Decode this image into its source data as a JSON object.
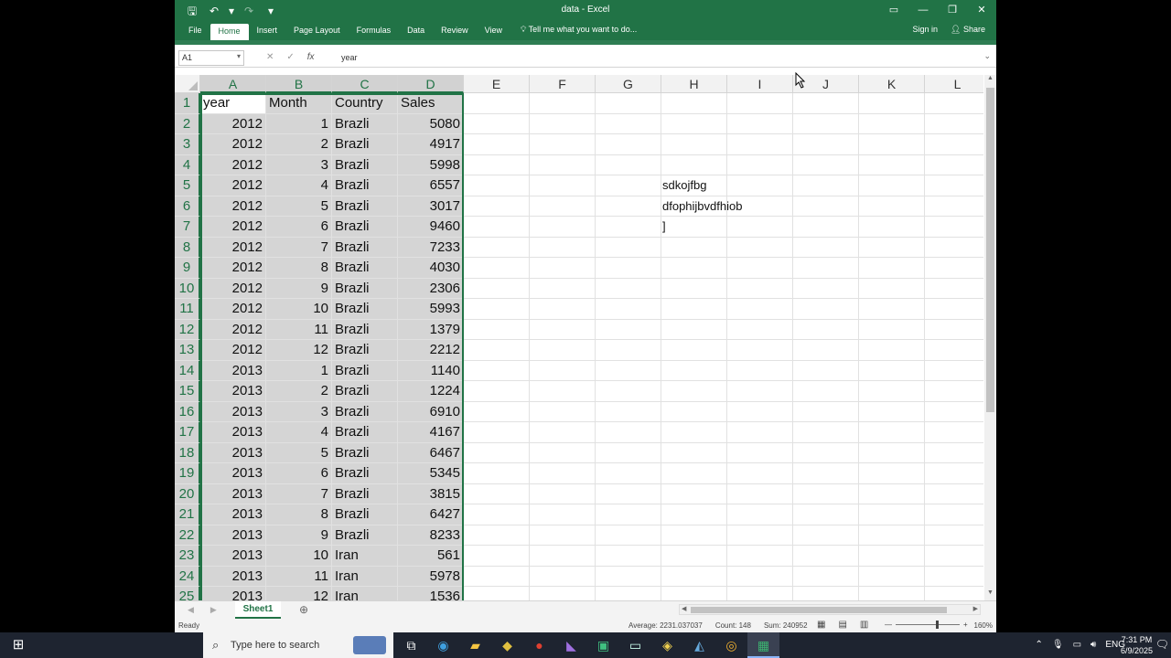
{
  "window": {
    "title": "data - Excel",
    "qat": {
      "save": "🖫",
      "undo": "↶",
      "undo_dd": "▾",
      "redo": "↷",
      "customize": "▾"
    },
    "controls": {
      "ribbon_display": "▭",
      "minimize": "—",
      "restore": "❐",
      "close": "✕"
    }
  },
  "ribbon": {
    "tabs": [
      "File",
      "Home",
      "Insert",
      "Page Layout",
      "Formulas",
      "Data",
      "Review",
      "View"
    ],
    "active_tab": "Home",
    "tell_me": "Tell me what you want to do...",
    "sign_in": "Sign in",
    "share": "Share"
  },
  "formula_bar": {
    "name_box": "A1",
    "cancel": "✕",
    "enter": "✓",
    "fx": "fx",
    "value": "year"
  },
  "columns": [
    {
      "label": "A"
    },
    {
      "label": "B"
    },
    {
      "label": "C"
    },
    {
      "label": "D"
    },
    {
      "label": "E"
    },
    {
      "label": "F"
    },
    {
      "label": "G"
    },
    {
      "label": "H"
    },
    {
      "label": "I"
    },
    {
      "label": "J"
    },
    {
      "label": "K"
    },
    {
      "label": "L"
    }
  ],
  "rows": [
    [
      "1",
      "year",
      "Month",
      "Country",
      "Sales"
    ],
    [
      "2",
      "2012",
      "1",
      "Brazli",
      "5080"
    ],
    [
      "3",
      "2012",
      "2",
      "Brazli",
      "4917"
    ],
    [
      "4",
      "2012",
      "3",
      "Brazli",
      "5998"
    ],
    [
      "5",
      "2012",
      "4",
      "Brazli",
      "6557"
    ],
    [
      "6",
      "2012",
      "5",
      "Brazli",
      "3017"
    ],
    [
      "7",
      "2012",
      "6",
      "Brazli",
      "9460"
    ],
    [
      "8",
      "2012",
      "7",
      "Brazli",
      "7233"
    ],
    [
      "9",
      "2012",
      "8",
      "Brazli",
      "4030"
    ],
    [
      "10",
      "2012",
      "9",
      "Brazli",
      "2306"
    ],
    [
      "11",
      "2012",
      "10",
      "Brazli",
      "5993"
    ],
    [
      "12",
      "2012",
      "11",
      "Brazli",
      "1379"
    ],
    [
      "13",
      "2012",
      "12",
      "Brazli",
      "2212"
    ],
    [
      "14",
      "2013",
      "1",
      "Brazli",
      "1140"
    ],
    [
      "15",
      "2013",
      "2",
      "Brazli",
      "1224"
    ],
    [
      "16",
      "2013",
      "3",
      "Brazli",
      "6910"
    ],
    [
      "17",
      "2013",
      "4",
      "Brazli",
      "4167"
    ],
    [
      "18",
      "2013",
      "5",
      "Brazli",
      "6467"
    ],
    [
      "19",
      "2013",
      "6",
      "Brazli",
      "5345"
    ],
    [
      "20",
      "2013",
      "7",
      "Brazli",
      "3815"
    ],
    [
      "21",
      "2013",
      "8",
      "Brazli",
      "6427"
    ],
    [
      "22",
      "2013",
      "9",
      "Brazli",
      "8233"
    ],
    [
      "23",
      "2013",
      "10",
      "Iran",
      "561"
    ],
    [
      "24",
      "2013",
      "11",
      "Iran",
      "5978"
    ],
    [
      "25",
      "2013",
      "12",
      "Iran",
      "1536"
    ]
  ],
  "free_text": {
    "h5": "sdkojfbg",
    "h6": "dfophijbvdfhiob",
    "h7": "]"
  },
  "sheets": {
    "active": "Sheet1",
    "add": "⊕"
  },
  "status": {
    "ready": "Ready",
    "average": "Average: 2231.037037",
    "count": "Count: 148",
    "sum": "Sum: 240952",
    "zoom": "160%"
  },
  "taskbar": {
    "search_placeholder": "Type here to search",
    "language": "ENG",
    "time": "7:31 PM",
    "date": "6/9/2025"
  },
  "colors": {
    "excel_green": "#217346",
    "taskbar": "#1e2430"
  }
}
